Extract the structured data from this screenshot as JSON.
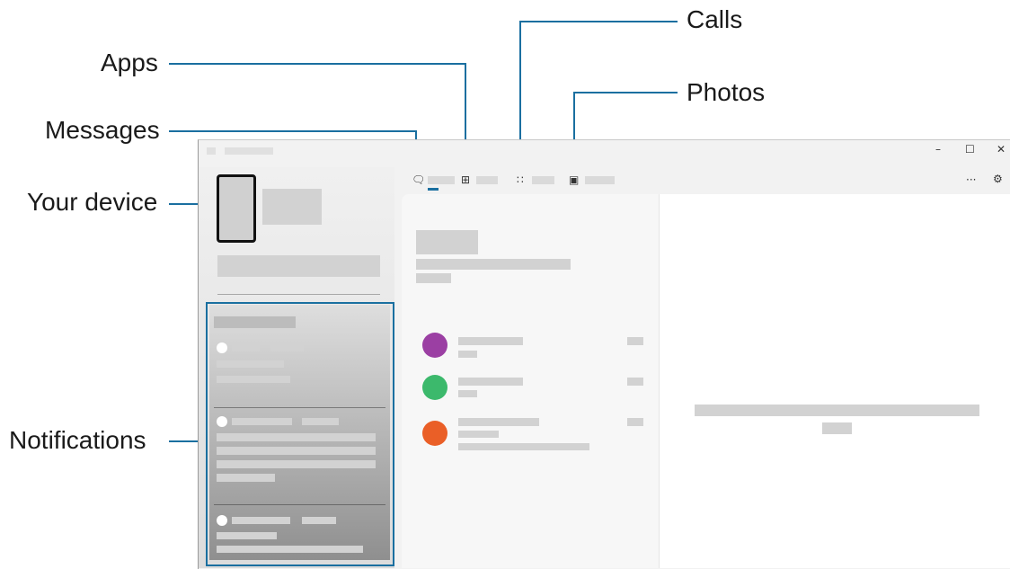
{
  "callouts": {
    "apps": "Apps",
    "messages": "Messages",
    "your_device": "Your device",
    "notifications": "Notifications",
    "calls": "Calls",
    "photos": "Photos"
  },
  "window": {
    "controls": {
      "minimize": "–",
      "maximize": "☐",
      "close": "✕"
    },
    "toolbar": {
      "more": "···",
      "settings": "⚙"
    }
  },
  "tabs": [
    {
      "icon": "messages-icon",
      "active": true
    },
    {
      "icon": "apps-icon"
    },
    {
      "icon": "calls-icon"
    },
    {
      "icon": "photos-icon"
    }
  ],
  "conversations": [
    {
      "avatar_color": "#9b3fa3"
    },
    {
      "avatar_color": "#3cb96c"
    },
    {
      "avatar_color": "#ea5f27"
    }
  ],
  "colors": {
    "accent": "#1a6fa0",
    "leader": "#1a6fa0"
  }
}
